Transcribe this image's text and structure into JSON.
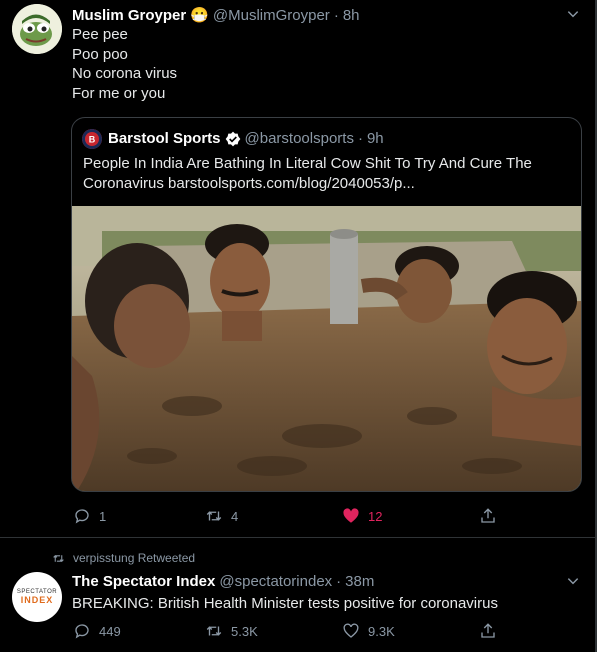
{
  "tweet1": {
    "name": "Muslim Groyper",
    "emoji": "😷",
    "handle": "@MuslimGroyper",
    "time": "8h",
    "lines": [
      "Pee pee",
      "Poo poo",
      "No corona virus",
      "For me or you"
    ],
    "quote": {
      "name": "Barstool Sports",
      "handle": "@barstoolsports",
      "time": "9h",
      "text_line1": "People In India Are Bathing In Literal Cow Shit To Try And Cure The",
      "text_line2": "Coronavirus barstoolsports.com/blog/2040053/p..."
    },
    "actions": {
      "replies": "1",
      "retweets": "4",
      "likes": "12"
    }
  },
  "tweet2": {
    "retweeted_by": "verpisstung Retweeted",
    "name": "The Spectator Index",
    "handle": "@spectatorindex",
    "time": "38m",
    "text": "BREAKING: British Health Minister tests positive for coronavirus",
    "avatar_text_top": "SPECTATOR",
    "avatar_text_bottom": "INDEX",
    "actions": {
      "replies": "449",
      "retweets": "5.3K",
      "likes": "9.3K"
    }
  },
  "colors": {
    "like_active": "#e0245e",
    "muted": "#8b98a5",
    "verified": "#ffffff"
  }
}
